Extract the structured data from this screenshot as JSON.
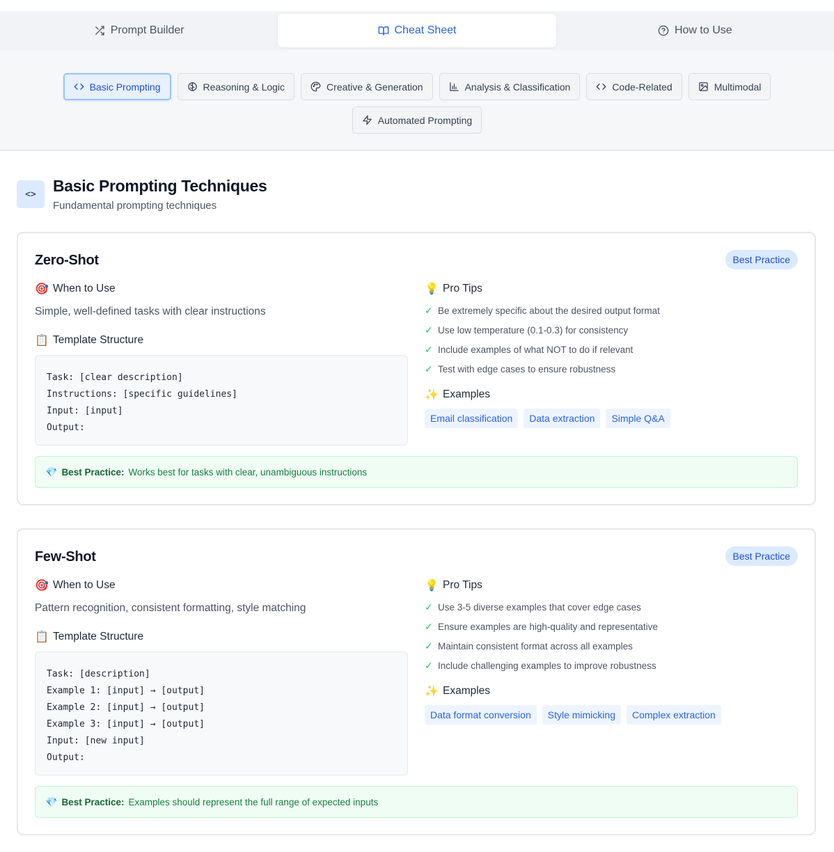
{
  "top_tabs": [
    {
      "label": "Prompt Builder",
      "icon": "shuffle-icon"
    },
    {
      "label": "Cheat Sheet",
      "icon": "book-open-icon",
      "active": true
    },
    {
      "label": "How to Use",
      "icon": "help-circle-icon"
    }
  ],
  "categories": [
    {
      "label": "Basic Prompting",
      "icon": "code-icon",
      "active": true
    },
    {
      "label": "Reasoning & Logic",
      "icon": "brain-icon"
    },
    {
      "label": "Creative & Generation",
      "icon": "palette-icon"
    },
    {
      "label": "Analysis & Classification",
      "icon": "bar-chart-icon"
    },
    {
      "label": "Code-Related",
      "icon": "code-icon"
    },
    {
      "label": "Multimodal",
      "icon": "image-icon"
    },
    {
      "label": "Automated Prompting",
      "icon": "zap-icon"
    }
  ],
  "section": {
    "icon_glyph": "<>",
    "title": "Basic Prompting Techniques",
    "subtitle": "Fundamental prompting techniques"
  },
  "labels": {
    "when_to_use": "When to Use",
    "template_structure": "Template Structure",
    "pro_tips": "Pro Tips",
    "examples": "Examples",
    "best_practice_prefix": "Best Practice:"
  },
  "cards": [
    {
      "title": "Zero-Shot",
      "badge": "Best Practice",
      "when": "Simple, well-defined tasks with clear instructions",
      "template": "Task: [clear description]\nInstructions: [specific guidelines]\nInput: [input]\nOutput:",
      "tips": [
        "Be extremely specific about the desired output format",
        "Use low temperature (0.1-0.3) for consistency",
        "Include examples of what NOT to do if relevant",
        "Test with edge cases to ensure robustness"
      ],
      "examples": [
        "Email classification",
        "Data extraction",
        "Simple Q&A"
      ],
      "best_practice": "Works best for tasks with clear, unambiguous instructions"
    },
    {
      "title": "Few-Shot",
      "badge": "Best Practice",
      "when": "Pattern recognition, consistent formatting, style matching",
      "template": "Task: [description]\nExample 1: [input] → [output]\nExample 2: [input] → [output]\nExample 3: [input] → [output]\nInput: [new input]\nOutput:",
      "tips": [
        "Use 3-5 diverse examples that cover edge cases",
        "Ensure examples are high-quality and representative",
        "Maintain consistent format across all examples",
        "Include challenging examples to improve robustness"
      ],
      "examples": [
        "Data format conversion",
        "Style mimicking",
        "Complex extraction"
      ],
      "best_practice": "Examples should represent the full range of expected inputs"
    }
  ]
}
